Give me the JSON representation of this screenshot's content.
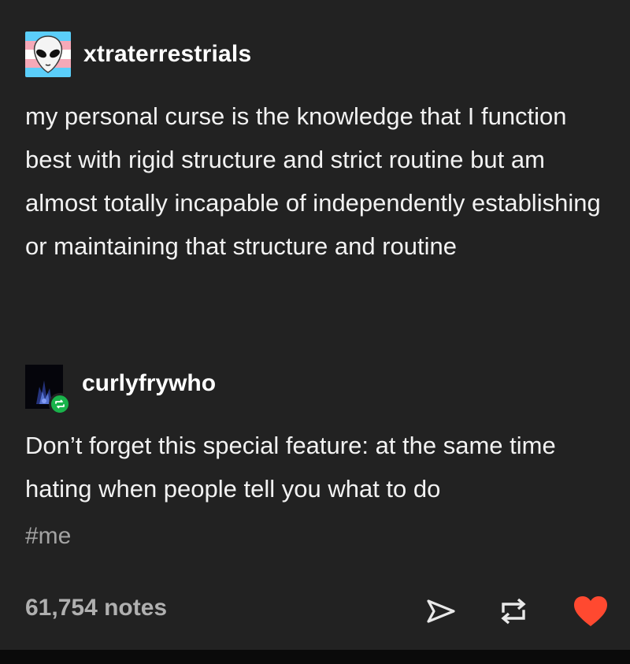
{
  "post": {
    "author": "xtraterrestrials",
    "body": "my personal curse is the knowledge that I function best with rigid structure and strict routine but am almost totally incapable of independently establishing or maintaining that structure and routine",
    "avatar_icon": "alien-icon",
    "avatar_flag_colors": [
      "#5bcefa",
      "#f5a9b8",
      "#ffffff",
      "#f5a9b8",
      "#5bcefa"
    ]
  },
  "reblog": {
    "author": "curlyfrywho",
    "body": "Don’t forget this special feature: at the same time hating when people tell you what to do",
    "badge_icon": "reblog-icon",
    "badge_color": "#19b34b"
  },
  "tags": [
    "#me"
  ],
  "footer": {
    "notes": "61,754 notes",
    "actions": [
      {
        "icon": "share-icon"
      },
      {
        "icon": "reblog-icon"
      },
      {
        "icon": "heart-icon",
        "color": "#ff4930"
      }
    ]
  },
  "colors": {
    "background": "#222222",
    "text": "#f2f2f2",
    "muted": "#a3a3a3",
    "like": "#ff4930",
    "reblog_badge": "#19b34b"
  }
}
